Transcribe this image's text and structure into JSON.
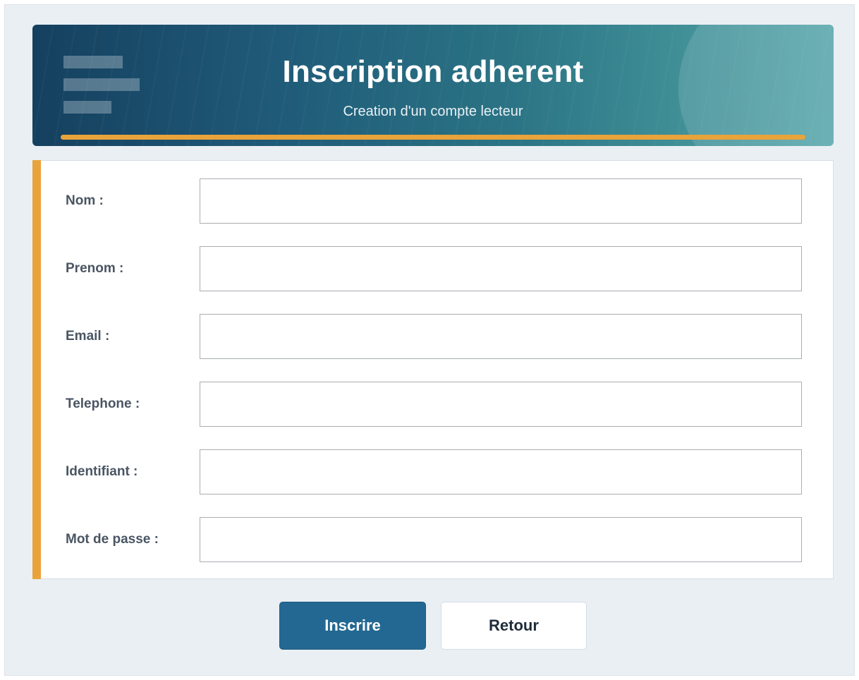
{
  "header": {
    "title": "Inscription adherent",
    "subtitle": "Creation d'un compte lecteur",
    "icon": "document-lines-icon"
  },
  "form": {
    "fields": [
      {
        "label": "Nom :",
        "value": ""
      },
      {
        "label": "Prenom :",
        "value": ""
      },
      {
        "label": "Email :",
        "value": ""
      },
      {
        "label": "Telephone :",
        "value": ""
      },
      {
        "label": "Identifiant :",
        "value": ""
      },
      {
        "label": "Mot de passe :",
        "value": ""
      }
    ]
  },
  "actions": {
    "submit_label": "Inscrire",
    "back_label": "Retour"
  },
  "colors": {
    "accent": "#e9a33b",
    "primary": "#236892",
    "banner_dark": "#15405f",
    "banner_light": "#58a7ab"
  }
}
